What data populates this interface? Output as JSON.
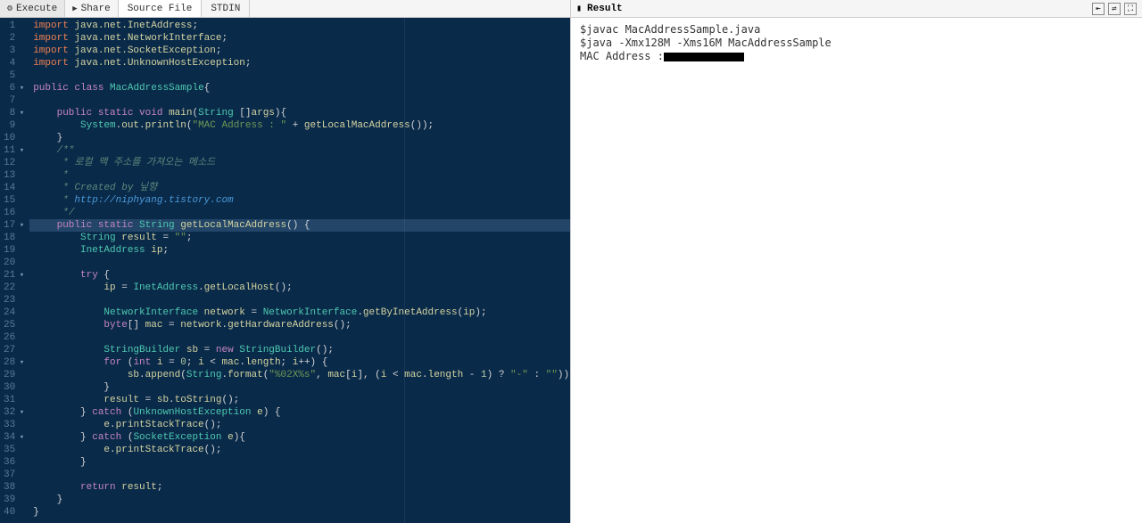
{
  "toolbar": {
    "execute": "Execute",
    "share": "Share",
    "source_file": "Source File",
    "stdin": "STDIN"
  },
  "result": {
    "title": "Result",
    "lines": [
      "$javac MacAddressSample.java",
      "$java -Xmx128M -Xms16M MacAddressSample",
      "MAC Address :"
    ]
  },
  "code": {
    "active_line": 17,
    "lines": [
      {
        "n": 1,
        "fold": "",
        "tokens": [
          [
            "pkw",
            "import"
          ],
          [
            "op",
            " "
          ],
          [
            "id",
            "java.net.InetAddress"
          ],
          [
            "op",
            ";"
          ]
        ]
      },
      {
        "n": 2,
        "fold": "",
        "tokens": [
          [
            "pkw",
            "import"
          ],
          [
            "op",
            " "
          ],
          [
            "id",
            "java.net.NetworkInterface"
          ],
          [
            "op",
            ";"
          ]
        ]
      },
      {
        "n": 3,
        "fold": "",
        "tokens": [
          [
            "pkw",
            "import"
          ],
          [
            "op",
            " "
          ],
          [
            "id",
            "java.net.SocketException"
          ],
          [
            "op",
            ";"
          ]
        ]
      },
      {
        "n": 4,
        "fold": "",
        "tokens": [
          [
            "pkw",
            "import"
          ],
          [
            "op",
            " "
          ],
          [
            "id",
            "java.net.UnknownHostException"
          ],
          [
            "op",
            ";"
          ]
        ]
      },
      {
        "n": 5,
        "fold": "",
        "tokens": []
      },
      {
        "n": 6,
        "fold": "▾",
        "tokens": [
          [
            "kw",
            "public"
          ],
          [
            "op",
            " "
          ],
          [
            "kw",
            "class"
          ],
          [
            "op",
            " "
          ],
          [
            "type",
            "MacAddressSample"
          ],
          [
            "op",
            "{"
          ]
        ]
      },
      {
        "n": 7,
        "fold": "",
        "tokens": []
      },
      {
        "n": 8,
        "fold": "▾",
        "tokens": [
          [
            "op",
            "    "
          ],
          [
            "kw",
            "public"
          ],
          [
            "op",
            " "
          ],
          [
            "kw",
            "static"
          ],
          [
            "op",
            " "
          ],
          [
            "kw",
            "void"
          ],
          [
            "op",
            " "
          ],
          [
            "id",
            "main"
          ],
          [
            "op",
            "("
          ],
          [
            "type",
            "String"
          ],
          [
            "op",
            " []"
          ],
          [
            "id",
            "args"
          ],
          [
            "op",
            "){"
          ]
        ]
      },
      {
        "n": 9,
        "fold": "",
        "tokens": [
          [
            "op",
            "        "
          ],
          [
            "type",
            "System"
          ],
          [
            "op",
            "."
          ],
          [
            "id",
            "out"
          ],
          [
            "op",
            "."
          ],
          [
            "id",
            "println"
          ],
          [
            "op",
            "("
          ],
          [
            "str",
            "\"MAC Address : \""
          ],
          [
            "op",
            " + "
          ],
          [
            "id",
            "getLocalMacAddress"
          ],
          [
            "op",
            "());"
          ]
        ]
      },
      {
        "n": 10,
        "fold": "",
        "tokens": [
          [
            "op",
            "    }"
          ]
        ]
      },
      {
        "n": 11,
        "fold": "▾",
        "tokens": [
          [
            "op",
            "    "
          ],
          [
            "cmt",
            "/**"
          ]
        ]
      },
      {
        "n": 12,
        "fold": "",
        "tokens": [
          [
            "op",
            "     "
          ],
          [
            "cmt",
            "* 로컬 맥 주소를 가져오는 메소드 "
          ]
        ]
      },
      {
        "n": 13,
        "fold": "",
        "tokens": [
          [
            "op",
            "     "
          ],
          [
            "cmt",
            "* "
          ]
        ]
      },
      {
        "n": 14,
        "fold": "",
        "tokens": [
          [
            "op",
            "     "
          ],
          [
            "cmt",
            "* Created by 닢향"
          ]
        ]
      },
      {
        "n": 15,
        "fold": "",
        "tokens": [
          [
            "op",
            "     "
          ],
          [
            "cmt",
            "* "
          ],
          [
            "cmt-link",
            "http://niphyang.tistory.com"
          ]
        ]
      },
      {
        "n": 16,
        "fold": "",
        "tokens": [
          [
            "op",
            "     "
          ],
          [
            "cmt",
            "*/"
          ]
        ]
      },
      {
        "n": 17,
        "fold": "▾",
        "tokens": [
          [
            "op",
            "    "
          ],
          [
            "kw",
            "public"
          ],
          [
            "op",
            " "
          ],
          [
            "kw",
            "static"
          ],
          [
            "op",
            " "
          ],
          [
            "type",
            "String"
          ],
          [
            "op",
            " "
          ],
          [
            "id",
            "getLocalMacAddress"
          ],
          [
            "op",
            "() {"
          ]
        ]
      },
      {
        "n": 18,
        "fold": "",
        "tokens": [
          [
            "op",
            "        "
          ],
          [
            "type",
            "String"
          ],
          [
            "op",
            " "
          ],
          [
            "id",
            "result"
          ],
          [
            "op",
            " = "
          ],
          [
            "str",
            "\"\""
          ],
          [
            "op",
            ";"
          ]
        ]
      },
      {
        "n": 19,
        "fold": "",
        "tokens": [
          [
            "op",
            "        "
          ],
          [
            "type",
            "InetAddress"
          ],
          [
            "op",
            " "
          ],
          [
            "id",
            "ip"
          ],
          [
            "op",
            ";"
          ]
        ]
      },
      {
        "n": 20,
        "fold": "",
        "tokens": []
      },
      {
        "n": 21,
        "fold": "▾",
        "tokens": [
          [
            "op",
            "        "
          ],
          [
            "kw",
            "try"
          ],
          [
            "op",
            " {"
          ]
        ]
      },
      {
        "n": 22,
        "fold": "",
        "tokens": [
          [
            "op",
            "            "
          ],
          [
            "id",
            "ip"
          ],
          [
            "op",
            " = "
          ],
          [
            "type",
            "InetAddress"
          ],
          [
            "op",
            "."
          ],
          [
            "id",
            "getLocalHost"
          ],
          [
            "op",
            "();"
          ]
        ]
      },
      {
        "n": 23,
        "fold": "",
        "tokens": [
          [
            "op",
            "             "
          ]
        ]
      },
      {
        "n": 24,
        "fold": "",
        "tokens": [
          [
            "op",
            "            "
          ],
          [
            "type",
            "NetworkInterface"
          ],
          [
            "op",
            " "
          ],
          [
            "id",
            "network"
          ],
          [
            "op",
            " = "
          ],
          [
            "type",
            "NetworkInterface"
          ],
          [
            "op",
            "."
          ],
          [
            "id",
            "getByInetAddress"
          ],
          [
            "op",
            "("
          ],
          [
            "id",
            "ip"
          ],
          [
            "op",
            ");"
          ]
        ]
      },
      {
        "n": 25,
        "fold": "",
        "tokens": [
          [
            "op",
            "            "
          ],
          [
            "kw",
            "byte"
          ],
          [
            "op",
            "[] "
          ],
          [
            "id",
            "mac"
          ],
          [
            "op",
            " = "
          ],
          [
            "id",
            "network"
          ],
          [
            "op",
            "."
          ],
          [
            "id",
            "getHardwareAddress"
          ],
          [
            "op",
            "();"
          ]
        ]
      },
      {
        "n": 26,
        "fold": "",
        "tokens": [
          [
            "op",
            "             "
          ]
        ]
      },
      {
        "n": 27,
        "fold": "",
        "tokens": [
          [
            "op",
            "            "
          ],
          [
            "type",
            "StringBuilder"
          ],
          [
            "op",
            " "
          ],
          [
            "id",
            "sb"
          ],
          [
            "op",
            " = "
          ],
          [
            "kw",
            "new"
          ],
          [
            "op",
            " "
          ],
          [
            "type",
            "StringBuilder"
          ],
          [
            "op",
            "();"
          ]
        ]
      },
      {
        "n": 28,
        "fold": "▾",
        "tokens": [
          [
            "op",
            "            "
          ],
          [
            "kw",
            "for"
          ],
          [
            "op",
            " ("
          ],
          [
            "kw",
            "int"
          ],
          [
            "op",
            " "
          ],
          [
            "id",
            "i"
          ],
          [
            "op",
            " = "
          ],
          [
            "num",
            "0"
          ],
          [
            "op",
            "; "
          ],
          [
            "id",
            "i"
          ],
          [
            "op",
            " < "
          ],
          [
            "id",
            "mac"
          ],
          [
            "op",
            "."
          ],
          [
            "id",
            "length"
          ],
          [
            "op",
            "; "
          ],
          [
            "id",
            "i"
          ],
          [
            "op",
            "++) {"
          ]
        ]
      },
      {
        "n": 29,
        "fold": "",
        "tokens": [
          [
            "op",
            "                "
          ],
          [
            "id",
            "sb"
          ],
          [
            "op",
            "."
          ],
          [
            "id",
            "append"
          ],
          [
            "op",
            "("
          ],
          [
            "type",
            "String"
          ],
          [
            "op",
            "."
          ],
          [
            "id",
            "format"
          ],
          [
            "op",
            "("
          ],
          [
            "str",
            "\"%02X%s\""
          ],
          [
            "op",
            ", "
          ],
          [
            "id",
            "mac"
          ],
          [
            "op",
            "["
          ],
          [
            "id",
            "i"
          ],
          [
            "op",
            "], ("
          ],
          [
            "id",
            "i"
          ],
          [
            "op",
            " < "
          ],
          [
            "id",
            "mac"
          ],
          [
            "op",
            "."
          ],
          [
            "id",
            "length"
          ],
          [
            "op",
            " - "
          ],
          [
            "num",
            "1"
          ],
          [
            "op",
            ") ? "
          ],
          [
            "str",
            "\"-\""
          ],
          [
            "op",
            " : "
          ],
          [
            "str",
            "\"\""
          ],
          [
            "op",
            "));"
          ]
        ]
      },
      {
        "n": 30,
        "fold": "",
        "tokens": [
          [
            "op",
            "            }"
          ]
        ]
      },
      {
        "n": 31,
        "fold": "",
        "tokens": [
          [
            "op",
            "            "
          ],
          [
            "id",
            "result"
          ],
          [
            "op",
            " = "
          ],
          [
            "id",
            "sb"
          ],
          [
            "op",
            "."
          ],
          [
            "id",
            "toString"
          ],
          [
            "op",
            "();"
          ]
        ]
      },
      {
        "n": 32,
        "fold": "▾",
        "tokens": [
          [
            "op",
            "        } "
          ],
          [
            "kw",
            "catch"
          ],
          [
            "op",
            " ("
          ],
          [
            "type",
            "UnknownHostException"
          ],
          [
            "op",
            " "
          ],
          [
            "id",
            "e"
          ],
          [
            "op",
            ") {"
          ]
        ]
      },
      {
        "n": 33,
        "fold": "",
        "tokens": [
          [
            "op",
            "            "
          ],
          [
            "id",
            "e"
          ],
          [
            "op",
            "."
          ],
          [
            "id",
            "printStackTrace"
          ],
          [
            "op",
            "();"
          ]
        ]
      },
      {
        "n": 34,
        "fold": "▾",
        "tokens": [
          [
            "op",
            "        } "
          ],
          [
            "kw",
            "catch"
          ],
          [
            "op",
            " ("
          ],
          [
            "type",
            "SocketException"
          ],
          [
            "op",
            " "
          ],
          [
            "id",
            "e"
          ],
          [
            "op",
            "){"
          ]
        ]
      },
      {
        "n": 35,
        "fold": "",
        "tokens": [
          [
            "op",
            "            "
          ],
          [
            "id",
            "e"
          ],
          [
            "op",
            "."
          ],
          [
            "id",
            "printStackTrace"
          ],
          [
            "op",
            "();"
          ]
        ]
      },
      {
        "n": 36,
        "fold": "",
        "tokens": [
          [
            "op",
            "        }"
          ]
        ]
      },
      {
        "n": 37,
        "fold": "",
        "tokens": [
          [
            "op",
            "             "
          ]
        ]
      },
      {
        "n": 38,
        "fold": "",
        "tokens": [
          [
            "op",
            "        "
          ],
          [
            "kw",
            "return"
          ],
          [
            "op",
            " "
          ],
          [
            "id",
            "result"
          ],
          [
            "op",
            ";"
          ]
        ]
      },
      {
        "n": 39,
        "fold": "",
        "tokens": [
          [
            "op",
            "    }"
          ]
        ]
      },
      {
        "n": 40,
        "fold": "",
        "tokens": [
          [
            "op",
            "}"
          ]
        ]
      }
    ]
  }
}
